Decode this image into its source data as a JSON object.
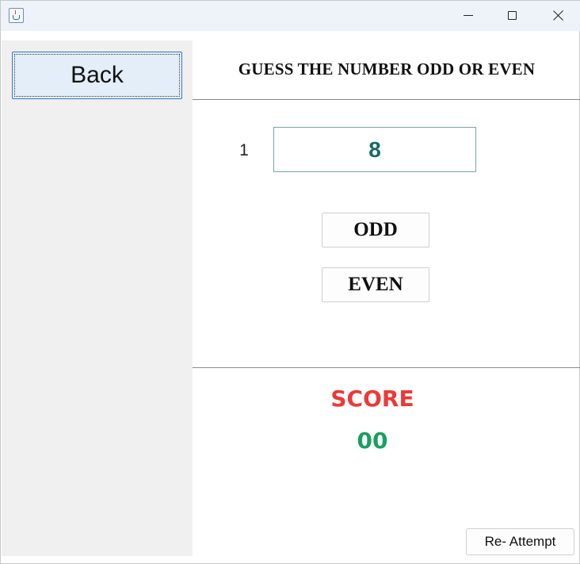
{
  "window": {
    "icon": "java-app-icon"
  },
  "sidebar": {
    "back_label": "Back"
  },
  "main": {
    "title": "GUESS THE NUMBER ODD OR EVEN",
    "counter": "1",
    "number": "8",
    "odd_label": "ODD",
    "even_label": "EVEN"
  },
  "score": {
    "label": "SCORE",
    "value": "00"
  },
  "footer": {
    "reattempt_label": "Re- Attempt"
  },
  "colors": {
    "score_label": "#ee3838",
    "score_value": "#17a060",
    "number": "#186a6a",
    "back_button_bg": "#e3eef9",
    "sidebar_bg": "#f0f0f0"
  }
}
